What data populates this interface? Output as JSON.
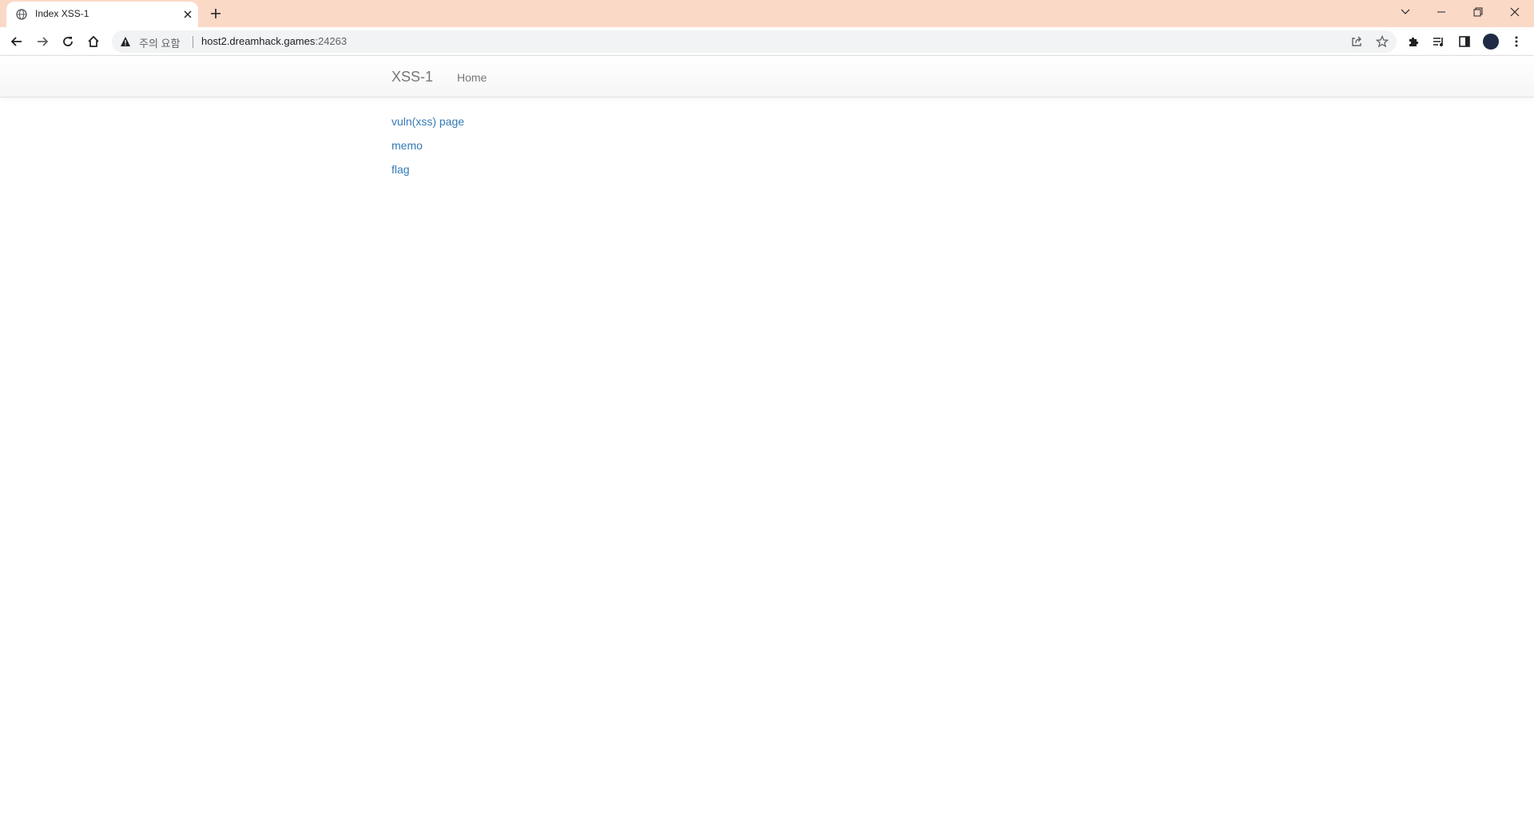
{
  "browser": {
    "tab": {
      "title": "Index XSS-1",
      "favicon": "globe-icon",
      "close_icon": "close-icon"
    },
    "new_tab_icon": "plus-icon",
    "window_controls": [
      "chevron-down-icon",
      "minimize-icon",
      "restore-icon",
      "close-icon"
    ],
    "toolbar": {
      "back_icon": "back-arrow-icon",
      "forward_icon": "forward-arrow-icon",
      "reload_icon": "reload-icon",
      "home_icon": "home-icon"
    },
    "address_bar": {
      "security_icon": "warning-icon",
      "security_label": "주의 요함",
      "url_host": "host2.dreamhack.games",
      "url_port": ":24263",
      "share_icon": "share-icon",
      "bookmark_icon": "star-icon"
    },
    "extensions_icon": "puzzle-icon",
    "media_icon": "playlist-icon",
    "side_panel_icon": "side-panel-icon",
    "profile_icon": "avatar",
    "menu_icon": "kebab-menu-icon",
    "colors": {
      "tabstrip_bg": "#fbd9c7",
      "omnibox_bg": "#f1f3f4"
    }
  },
  "page": {
    "navbar": {
      "brand": "XSS-1",
      "home": "Home"
    },
    "links": [
      {
        "label": "vuln(xss) page"
      },
      {
        "label": "memo"
      },
      {
        "label": "flag"
      }
    ],
    "colors": {
      "link": "#337ab7",
      "nav_text": "#777777"
    }
  }
}
